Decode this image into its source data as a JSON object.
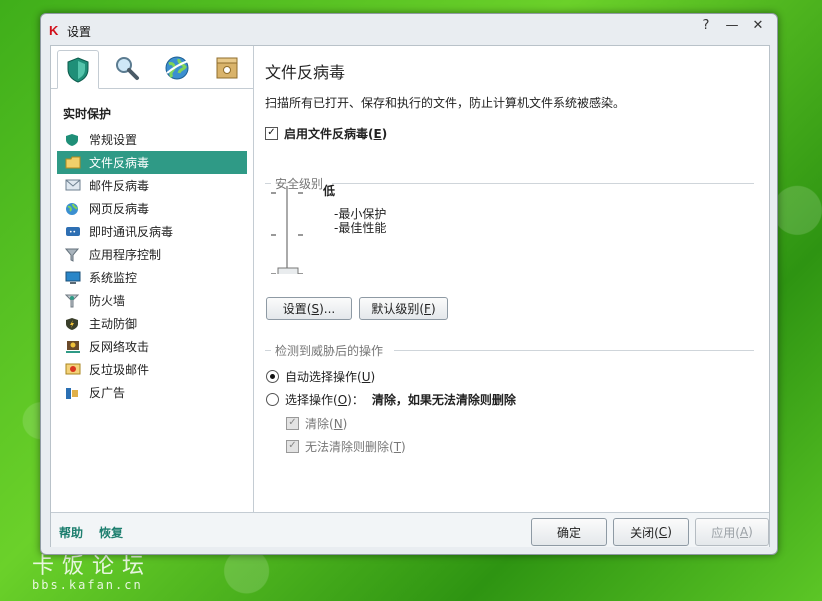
{
  "window": {
    "title": "设置",
    "app_icon": "K"
  },
  "tabs": [
    {
      "name": "protection-tab",
      "icon": "shield-icon"
    },
    {
      "name": "scan-tab",
      "icon": "magnifier-icon"
    },
    {
      "name": "update-tab",
      "icon": "globe-icon"
    },
    {
      "name": "settings-tab",
      "icon": "box-icon"
    }
  ],
  "sidebar": {
    "section_title": "实时保护",
    "items": [
      {
        "label": "常规设置",
        "icon": "shield-icon"
      },
      {
        "label": "文件反病毒",
        "icon": "folder-icon"
      },
      {
        "label": "邮件反病毒",
        "icon": "mail-icon"
      },
      {
        "label": "网页反病毒",
        "icon": "globe-icon"
      },
      {
        "label": "即时通讯反病毒",
        "icon": "chat-icon"
      },
      {
        "label": "应用程序控制",
        "icon": "funnel-icon"
      },
      {
        "label": "系统监控",
        "icon": "monitor-icon"
      },
      {
        "label": "防火墙",
        "icon": "firewall-icon"
      },
      {
        "label": "主动防御",
        "icon": "defense-icon"
      },
      {
        "label": "反网络攻击",
        "icon": "network-attack-icon"
      },
      {
        "label": "反垃圾邮件",
        "icon": "antispam-icon"
      },
      {
        "label": "反广告",
        "icon": "antibanner-icon"
      }
    ],
    "selected_index": 1
  },
  "main": {
    "title": "文件反病毒",
    "description": "扫描所有已打开、保存和执行的文件，防止计算机文件系统被感染。",
    "enable_label": "启用文件反病毒(",
    "enable_key": "E",
    "enable_suffix": ")",
    "enable_checked": true,
    "security_level": {
      "group_title": "安全级别",
      "level_name": "低",
      "bullets": [
        "-最小保护",
        "-最佳性能"
      ],
      "level_fraction": 0.0,
      "settings_button": "设置(",
      "settings_key": "S",
      "settings_suffix": ")...",
      "default_button": "默认级别(",
      "default_key": "F",
      "default_suffix": ")"
    },
    "action": {
      "group_title": "检测到威胁后的操作",
      "auto_label": "自动选择操作(",
      "auto_key": "U",
      "auto_suffix": ")",
      "auto_selected": true,
      "choose_label": "选择操作(",
      "choose_key": "O",
      "choose_suffix": ")：",
      "choose_value": "清除，如果无法清除则删除",
      "choose_selected": false,
      "clean_label": "清除(",
      "clean_key": "N",
      "clean_suffix": ")",
      "clean_checked": true,
      "delete_label": "无法清除则删除(",
      "delete_key": "T",
      "delete_suffix": ")",
      "delete_checked": true
    }
  },
  "footer": {
    "help": "帮助",
    "restore": "恢复",
    "ok": "确定",
    "close_label": "关闭(",
    "close_key": "C",
    "close_suffix": ")",
    "apply_label": "应用(",
    "apply_key": "A",
    "apply_suffix": ")"
  },
  "watermark": {
    "line1": "卡饭论坛",
    "line2": "bbs.kafan.cn"
  },
  "colors": {
    "selected_item": "#2f9a86",
    "link": "#1e7f6f",
    "brand_red": "#d10f1a"
  }
}
